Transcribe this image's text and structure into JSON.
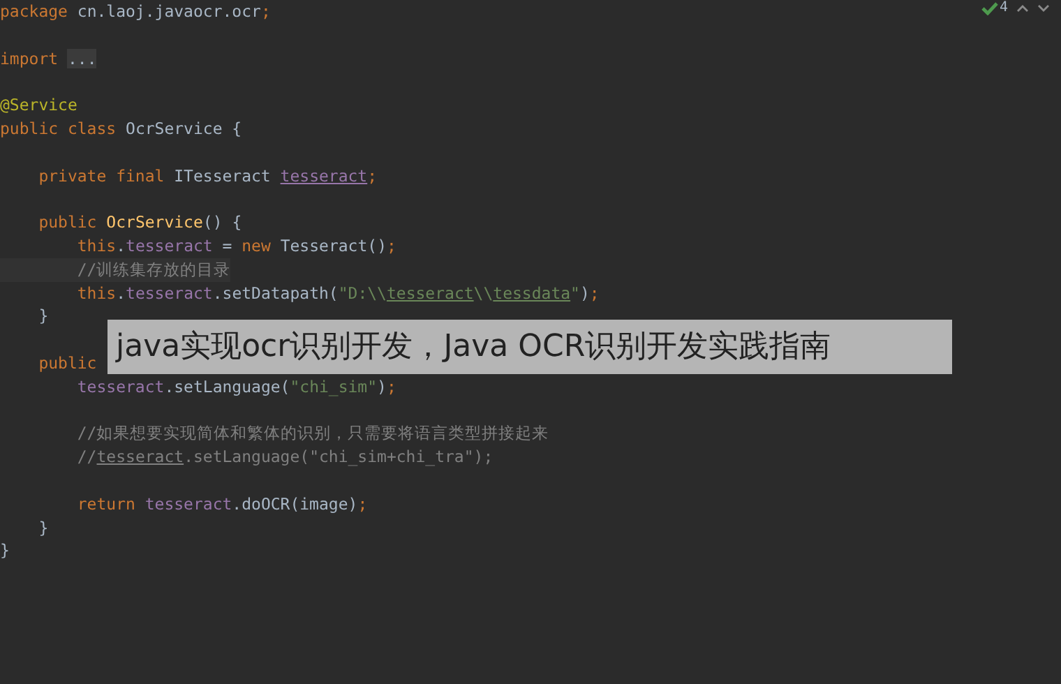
{
  "inspection": {
    "count": "4"
  },
  "lines": [
    {
      "kind": "code",
      "tokens": [
        {
          "kind": "kw",
          "t": "package "
        },
        {
          "kind": "plain",
          "t": "cn.laoj.javaocr.ocr"
        },
        {
          "kind": "kw",
          "t": ";"
        }
      ]
    },
    {
      "kind": "blank"
    },
    {
      "kind": "code",
      "tokens": [
        {
          "kind": "kw",
          "t": "import "
        },
        {
          "kind": "fold",
          "t": "..."
        }
      ]
    },
    {
      "kind": "blank"
    },
    {
      "kind": "code",
      "tokens": [
        {
          "kind": "ann",
          "t": "@Service"
        }
      ]
    },
    {
      "kind": "code",
      "tokens": [
        {
          "kind": "kw",
          "t": "public class "
        },
        {
          "kind": "plain",
          "t": "OcrService {"
        }
      ]
    },
    {
      "kind": "blank"
    },
    {
      "kind": "code",
      "tokens": [
        {
          "kind": "kw",
          "t": "    private final "
        },
        {
          "kind": "plain",
          "t": "ITesseract "
        },
        {
          "kind": "ul",
          "t": "tesseract"
        },
        {
          "kind": "kw",
          "t": ";"
        }
      ]
    },
    {
      "kind": "blank"
    },
    {
      "kind": "code",
      "tokens": [
        {
          "kind": "kw",
          "t": "    public "
        },
        {
          "kind": "fn",
          "t": "OcrService"
        },
        {
          "kind": "plain",
          "t": "() {"
        }
      ]
    },
    {
      "kind": "code",
      "tokens": [
        {
          "kind": "kw",
          "t": "        this"
        },
        {
          "kind": "plain",
          "t": "."
        },
        {
          "kind": "field",
          "t": "tesseract"
        },
        {
          "kind": "plain",
          "t": " = "
        },
        {
          "kind": "kw",
          "t": "new "
        },
        {
          "kind": "plain",
          "t": "Tesseract()"
        },
        {
          "kind": "kw",
          "t": ";"
        }
      ]
    },
    {
      "kind": "current",
      "tokens": [
        {
          "kind": "comment",
          "t": "        //训练集存放的目录"
        }
      ]
    },
    {
      "kind": "code",
      "tokens": [
        {
          "kind": "kw",
          "t": "        this"
        },
        {
          "kind": "plain",
          "t": "."
        },
        {
          "kind": "field",
          "t": "tesseract"
        },
        {
          "kind": "plain",
          "t": ".setDatapath("
        },
        {
          "kind": "string",
          "t": "\"D:\\\\"
        },
        {
          "kind": "sul",
          "t": "tesseract"
        },
        {
          "kind": "string",
          "t": "\\\\"
        },
        {
          "kind": "sul",
          "t": "tessdata"
        },
        {
          "kind": "string",
          "t": "\""
        },
        {
          "kind": "plain",
          "t": ")"
        },
        {
          "kind": "kw",
          "t": ";"
        }
      ]
    },
    {
      "kind": "code",
      "tokens": [
        {
          "kind": "plain",
          "t": "    }"
        }
      ]
    },
    {
      "kind": "blank"
    },
    {
      "kind": "code",
      "tokens": [
        {
          "kind": "kw",
          "t": "    public"
        }
      ]
    },
    {
      "kind": "code",
      "tokens": [
        {
          "kind": "field",
          "t": "        tesseract"
        },
        {
          "kind": "plain",
          "t": ".setLanguage("
        },
        {
          "kind": "string",
          "t": "\"chi_sim\""
        },
        {
          "kind": "plain",
          "t": ")"
        },
        {
          "kind": "kw",
          "t": ";"
        }
      ]
    },
    {
      "kind": "blank"
    },
    {
      "kind": "code",
      "tokens": [
        {
          "kind": "comment",
          "t": "        //如果想要实现简体和繁体的识别，只需要将语言类型拼接起来"
        }
      ]
    },
    {
      "kind": "code",
      "tokens": [
        {
          "kind": "comment",
          "t": "        //"
        },
        {
          "kind": "cul",
          "t": "tesseract"
        },
        {
          "kind": "comment",
          "t": ".setLanguage(\"chi_sim+chi_tra\");"
        }
      ]
    },
    {
      "kind": "blank"
    },
    {
      "kind": "code",
      "tokens": [
        {
          "kind": "kw",
          "t": "        return "
        },
        {
          "kind": "field",
          "t": "tesseract"
        },
        {
          "kind": "plain",
          "t": ".doOCR(image)"
        },
        {
          "kind": "kw",
          "t": ";"
        }
      ]
    },
    {
      "kind": "code",
      "tokens": [
        {
          "kind": "plain",
          "t": "    }"
        }
      ]
    },
    {
      "kind": "code",
      "tokens": [
        {
          "kind": "plain",
          "t": "}"
        }
      ]
    }
  ],
  "caption": "java实现ocr识别开发，Java OCR识别开发实践指南"
}
